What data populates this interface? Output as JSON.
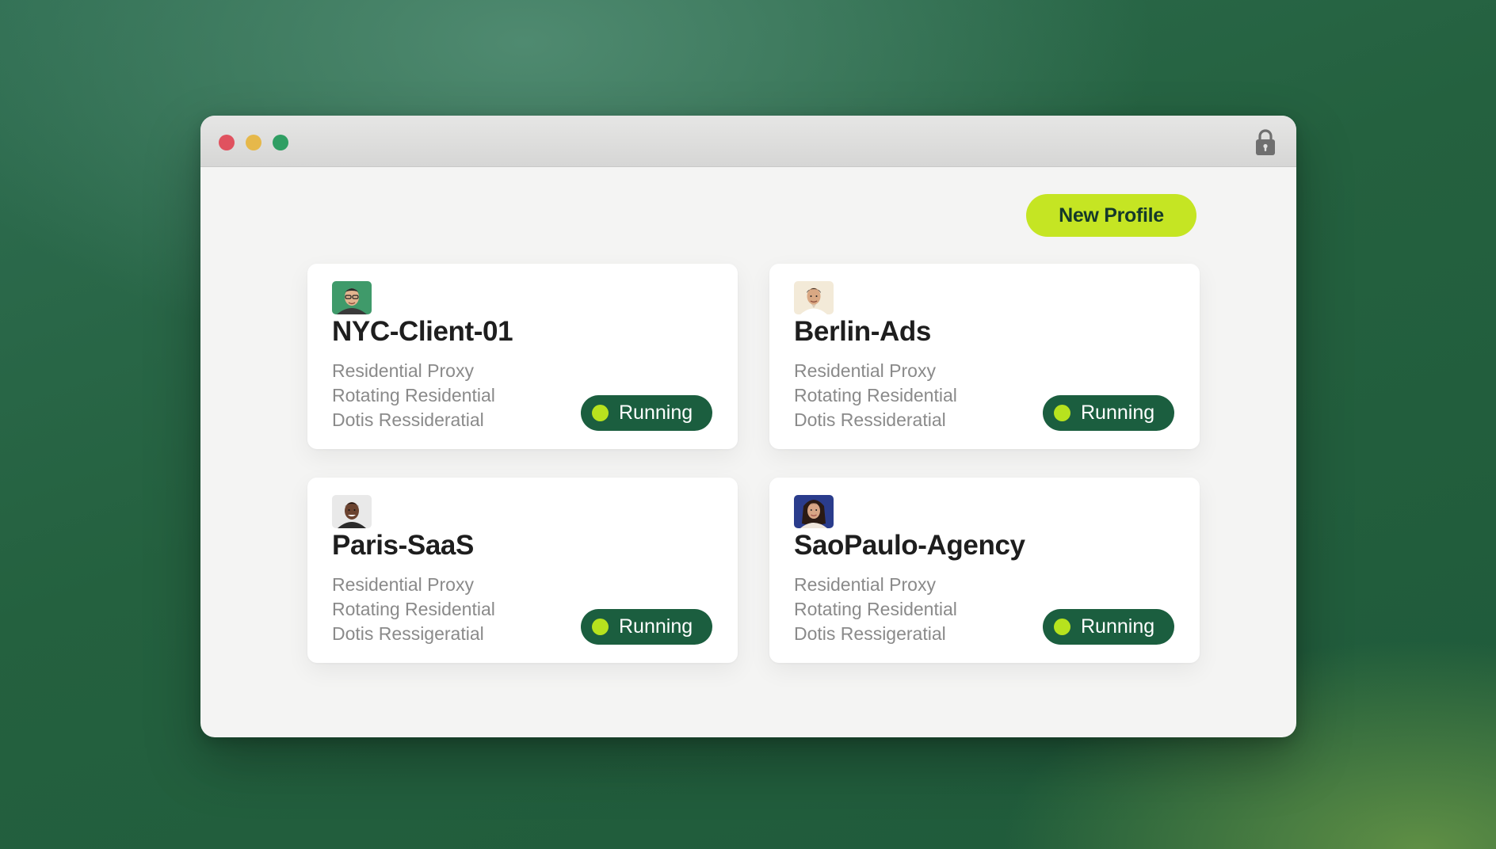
{
  "toolbar": {
    "new_profile_label": "New Profile"
  },
  "icons": {
    "lock": "lock-icon"
  },
  "colors": {
    "accent": "#c5e523",
    "status_bg": "#1b5e3f",
    "status_dot": "#b7e21e"
  },
  "profiles": [
    {
      "name": "NYC-Client-01",
      "lines": [
        "Residential Proxy",
        "Rotating Residential",
        "Dotis Ressideratial"
      ],
      "status": "Running"
    },
    {
      "name": "Berlin-Ads",
      "lines": [
        "Residential Proxy",
        "Rotating Residential",
        "Dotis Ressideratial"
      ],
      "status": "Running"
    },
    {
      "name": "Paris-SaaS",
      "lines": [
        "Residential Proxy",
        "Rotating Residential",
        "Dotis Ressigeratial"
      ],
      "status": "Running"
    },
    {
      "name": "SaoPaulo-Agency",
      "lines": [
        "Residential Proxy",
        "Rotating Residential",
        "Dotis Ressigeratial"
      ],
      "status": "Running"
    }
  ]
}
